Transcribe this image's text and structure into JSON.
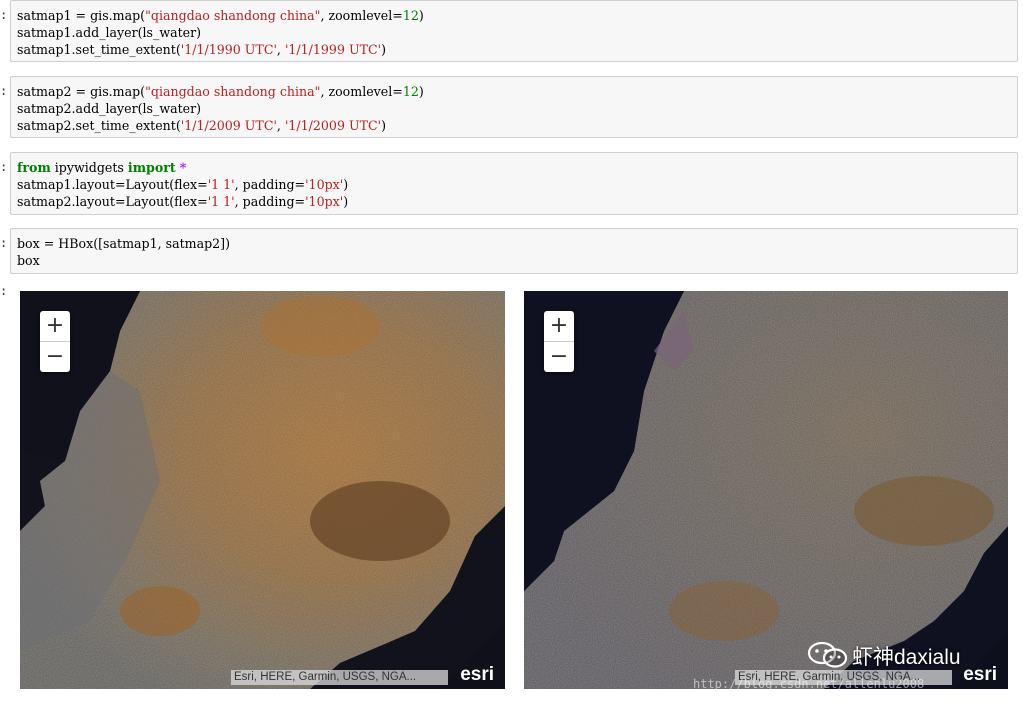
{
  "cells": [
    {
      "prompt": ":",
      "lines": [
        [
          {
            "t": "satmap1 = gis.map("
          },
          {
            "t": "\"qiangdao shandong china\"",
            "c": "str"
          },
          {
            "t": ", zoomlevel="
          },
          {
            "t": "12",
            "c": "num"
          },
          {
            "t": ")"
          }
        ],
        [
          {
            "t": "satmap1.add_layer(ls_water)"
          }
        ],
        [
          {
            "t": "satmap1.set_time_extent("
          },
          {
            "t": "'1/1/1990 UTC'",
            "c": "str"
          },
          {
            "t": ", "
          },
          {
            "t": "'1/1/1999 UTC'",
            "c": "str"
          },
          {
            "t": ")"
          }
        ]
      ]
    },
    {
      "prompt": ":",
      "lines": [
        [
          {
            "t": "satmap2 = gis.map("
          },
          {
            "t": "\"qiangdao shandong china\"",
            "c": "str"
          },
          {
            "t": ", zoomlevel="
          },
          {
            "t": "12",
            "c": "num"
          },
          {
            "t": ")"
          }
        ],
        [
          {
            "t": "satmap2.add_layer(ls_water)"
          }
        ],
        [
          {
            "t": "satmap2.set_time_extent("
          },
          {
            "t": "'1/1/2009 UTC'",
            "c": "str"
          },
          {
            "t": ", "
          },
          {
            "t": "'1/1/2009 UTC'",
            "c": "str"
          },
          {
            "t": ")"
          }
        ]
      ]
    },
    {
      "prompt": ":",
      "lines": [
        [
          {
            "t": "from",
            "c": "kw"
          },
          {
            "t": " ipywidgets "
          },
          {
            "t": "import",
            "c": "kw"
          },
          {
            "t": " "
          },
          {
            "t": "*",
            "c": "op"
          }
        ],
        [
          {
            "t": "satmap1.layout=Layout(flex="
          },
          {
            "t": "'1 1'",
            "c": "str"
          },
          {
            "t": ", padding="
          },
          {
            "t": "'10px'",
            "c": "str"
          },
          {
            "t": ")"
          }
        ],
        [
          {
            "t": "satmap2.layout=Layout(flex="
          },
          {
            "t": "'1 1'",
            "c": "str"
          },
          {
            "t": ", padding="
          },
          {
            "t": "'10px'",
            "c": "str"
          },
          {
            "t": ")"
          }
        ]
      ]
    },
    {
      "prompt": ":",
      "lines": [
        [
          {
            "t": "box = HBox([satmap1, satmap2])"
          }
        ],
        [
          {
            "t": "box"
          }
        ]
      ]
    }
  ],
  "output_prompt": ":",
  "maps": [
    {
      "zoom_in": "+",
      "zoom_out": "−",
      "attribution": "Esri, HERE, Garmin, USGS, NGA...",
      "logo": "esri",
      "tone": "1990"
    },
    {
      "zoom_in": "+",
      "zoom_out": "−",
      "attribution": "Esri, HERE, Garmin, USGS, NGA...",
      "logo": "esri",
      "tone": "2009"
    }
  ],
  "watermark": {
    "text": "虾神daxialu",
    "url": "http://blog.csdn.net/allenlu2008"
  },
  "colors": {
    "string": "#ba2121",
    "number": "#008000",
    "keyword": "#008000",
    "operator": "#aa22ff",
    "cell_bg": "#f7f7f7",
    "cell_border": "#cfcfcf"
  }
}
